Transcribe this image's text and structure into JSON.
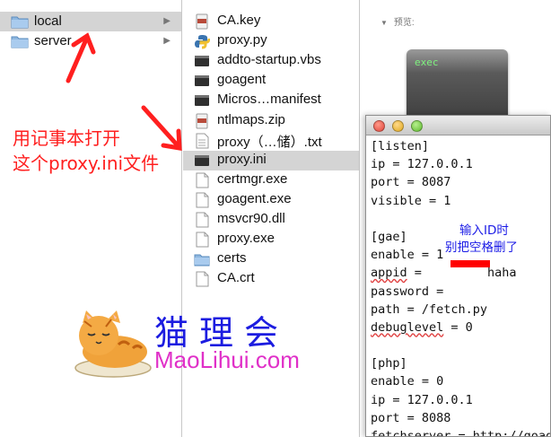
{
  "sidebar": {
    "items": [
      {
        "label": "local",
        "selected": true
      },
      {
        "label": "server",
        "selected": false
      }
    ]
  },
  "files": {
    "items": [
      {
        "label": "CA.key",
        "icon": "zip-file-icon"
      },
      {
        "label": "proxy.py",
        "icon": "python-file-icon"
      },
      {
        "label": "addto-startup.vbs",
        "icon": "script-file-icon"
      },
      {
        "label": "goagent",
        "icon": "executable-file-icon"
      },
      {
        "label": "Micros…manifest",
        "icon": "script-file-icon"
      },
      {
        "label": "ntlmaps.zip",
        "icon": "zip-file-icon"
      },
      {
        "label": "proxy（…储）.txt",
        "icon": "text-file-icon"
      },
      {
        "label": "proxy.ini",
        "icon": "executable-file-icon",
        "selected": true
      },
      {
        "label": "certmgr.exe",
        "icon": "document-file-icon"
      },
      {
        "label": "goagent.exe",
        "icon": "document-file-icon"
      },
      {
        "label": "msvcr90.dll",
        "icon": "document-file-icon"
      },
      {
        "label": "proxy.exe",
        "icon": "document-file-icon"
      },
      {
        "label": "certs",
        "icon": "folder-icon"
      },
      {
        "label": "CA.crt",
        "icon": "document-file-icon"
      }
    ]
  },
  "preview": {
    "heading": "预览:",
    "icon_text": "exec"
  },
  "editor": {
    "lines": [
      "[listen]",
      "ip = 127.0.0.1",
      "port = 8087",
      "visible = 1",
      "",
      "[gae]",
      "enable = 1",
      "appid =         haha",
      "password =",
      "path = /fetch.py",
      "debuglevel = 0",
      "",
      "[php]",
      "enable = 0",
      "ip = 127.0.0.1",
      "port = 8088",
      "fetchserver = http://goag"
    ]
  },
  "annotations": {
    "red_line1": "用记事本打开",
    "red_line2": "这个proxy.ini文件",
    "blue_line1": "输入ID时",
    "blue_line2": "别把空格删了",
    "watermark_cn": "猫理会",
    "watermark_en": "MaoLihui.com"
  },
  "colors": {
    "selection": "#d4d4d4",
    "annotation_red": "#ff1f1f",
    "annotation_blue": "#1a1ae6",
    "watermark_pink": "#e030c8"
  }
}
